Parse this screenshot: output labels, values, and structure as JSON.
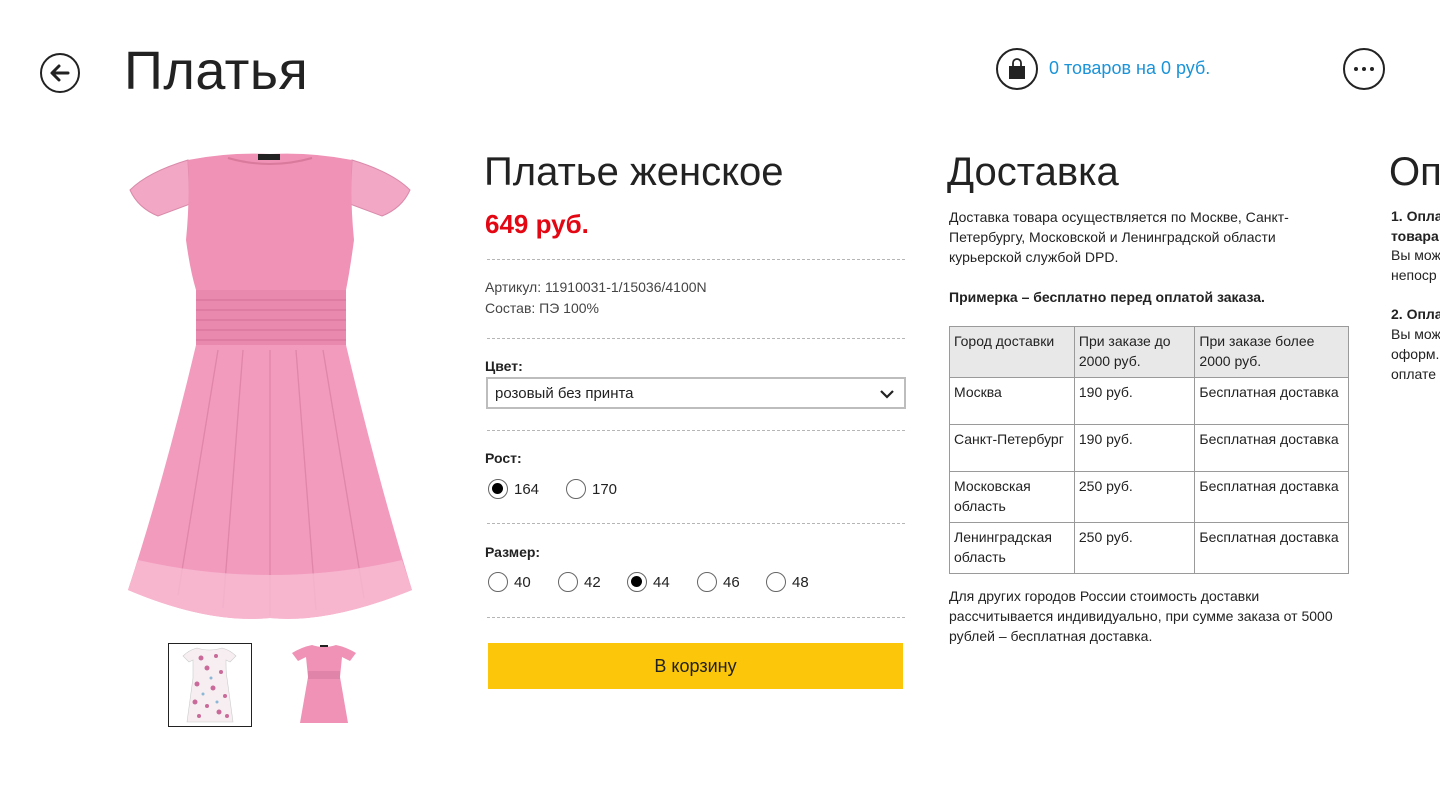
{
  "header": {
    "title": "Платья",
    "cart_text": "0 товаров на 0 руб."
  },
  "product": {
    "title": "Платье женское",
    "price": "649 руб.",
    "article": "Артикул: 11910031-1/15036/4100N",
    "composition": "Состав: ПЭ 100%",
    "color_label": "Цвет:",
    "color_value": "розовый без принта",
    "height_label": "Рост:",
    "heights": [
      {
        "label": "164",
        "selected": true
      },
      {
        "label": "170",
        "selected": false
      }
    ],
    "size_label": "Размер:",
    "sizes": [
      {
        "label": "40",
        "selected": false
      },
      {
        "label": "42",
        "selected": false
      },
      {
        "label": "44",
        "selected": true
      },
      {
        "label": "46",
        "selected": false
      },
      {
        "label": "48",
        "selected": false
      }
    ],
    "buy_label": "В корзину",
    "dress_color": "#ef92b5",
    "thumbnails": [
      {
        "style": "floral print",
        "selected": true
      },
      {
        "style": "pink plain",
        "selected": false
      }
    ]
  },
  "delivery": {
    "title": "Доставка",
    "intro": "Доставка товара осуществляется по Москве, Санкт-Петербургу, Московской и Ленинградской области курьерской службой DPD.",
    "fitting": "Примерка – бесплатно перед оплатой заказа.",
    "table": {
      "headers": [
        "Город доставки",
        "При заказе до 2000 руб.",
        "При заказе более 2000 руб."
      ],
      "rows": [
        [
          "Москва",
          "190 руб.",
          "Бесплатная доставка"
        ],
        [
          "Санкт-Петербург",
          "190 руб.",
          "Бесплатная доставка"
        ],
        [
          "Московская область",
          "250 руб.",
          "Бесплатная доставка"
        ],
        [
          "Ленинградская область",
          "250 руб.",
          "Бесплатная доставка"
        ]
      ]
    },
    "other": "Для других городов России стоимость доставки рассчитывается индивидуально, при сумме заказа от 5000 рублей – бесплатная доставка."
  },
  "payment": {
    "title": "Оп",
    "lines": [
      {
        "text": "1. Опла",
        "bold": true
      },
      {
        "text": "товара",
        "bold": true
      },
      {
        "text": "Вы мож",
        "bold": false
      },
      {
        "text": "непоср",
        "bold": false
      },
      {
        "text": "2. Опла",
        "bold": true
      },
      {
        "text": "Вы мож",
        "bold": false
      },
      {
        "text": "оформ.",
        "bold": false
      },
      {
        "text": "оплате",
        "bold": false
      }
    ]
  },
  "colors": {
    "accent_link": "#1a93d8",
    "price": "#e30613",
    "buy_button": "#fcc70a"
  }
}
